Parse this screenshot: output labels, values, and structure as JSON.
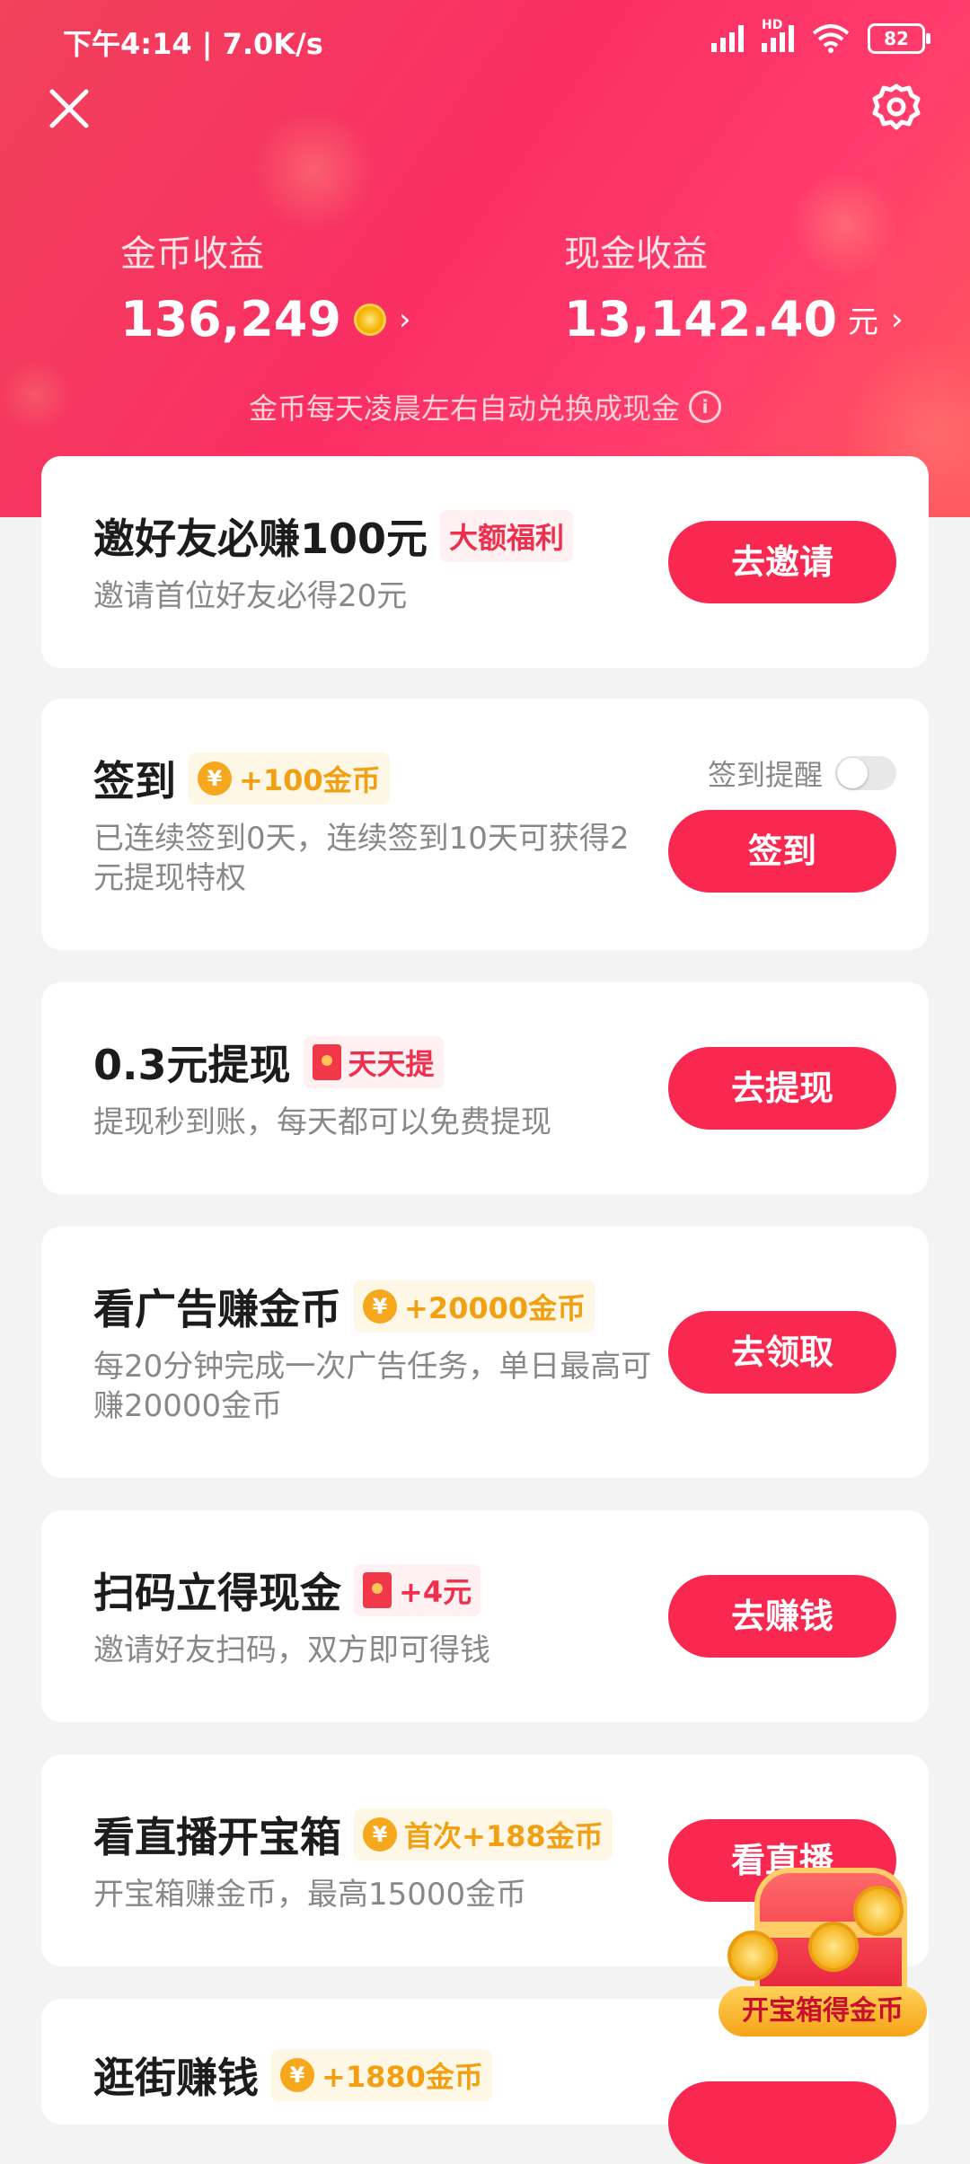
{
  "status_bar": {
    "time_speed": "下午4:14 | 7.0K/s",
    "hd_label": "HD",
    "battery": "82"
  },
  "header": {
    "coin_income_label": "金币收益",
    "coin_income_value": "136,249",
    "cash_income_label": "现金收益",
    "cash_income_value": "13,142.40",
    "cash_unit": "元",
    "chevron": "›",
    "hint": "金币每天凌晨左右自动兑换成现金",
    "info_glyph": "i"
  },
  "tasks": [
    {
      "title": "邀好友必赚100元",
      "badge": "大额福利",
      "desc": "邀请首位好友必得20元",
      "button": "去邀请"
    },
    {
      "title": "签到",
      "badge": "+100金币",
      "desc": "已连续签到0天，连续签到10天可获得2元提现特权",
      "button": "签到",
      "reminder_label": "签到提醒"
    },
    {
      "title": "0.3元提现",
      "badge": "天天提",
      "desc": "提现秒到账，每天都可以免费提现",
      "button": "去提现"
    },
    {
      "title": "看广告赚金币",
      "badge": "+20000金币",
      "desc": "每20分钟完成一次广告任务，单日最高可赚20000金币",
      "button": "去领取"
    },
    {
      "title": "扫码立得现金",
      "badge": "+4元",
      "desc": "邀请好友扫码，双方即可得钱",
      "button": "去赚钱"
    },
    {
      "title": "看直播开宝箱",
      "badge": "首次+188金币",
      "desc": "开宝箱赚金币，最高15000金币",
      "button": "看直播"
    },
    {
      "title": "逛街赚钱",
      "badge": "+1880金币"
    }
  ],
  "yen_glyph": "¥",
  "treasure": {
    "label": "开宝箱得金币"
  },
  "colors": {
    "primary": "#f82850",
    "gold": "#f0a012",
    "header_start": "#f0425a",
    "header_end": "#ff5a5f"
  }
}
